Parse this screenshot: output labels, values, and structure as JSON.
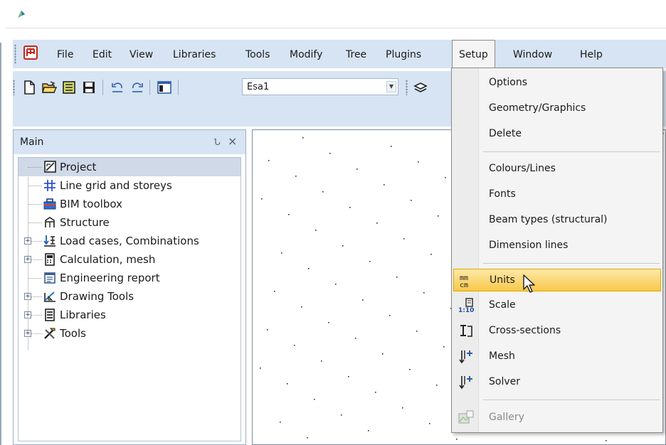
{
  "menubar": {
    "items": [
      "File",
      "Edit",
      "View",
      "Libraries",
      "Tools",
      "Modify",
      "Tree",
      "Plugins",
      "Setup",
      "Window",
      "Help"
    ],
    "active": "Setup"
  },
  "toolbar": {
    "project_combo_value": "Esa1"
  },
  "panel": {
    "title": "Main",
    "pin_glyph": "Ն",
    "close_glyph": "×"
  },
  "tree": {
    "items": [
      {
        "label": "Project",
        "icon": "project-icon",
        "expandable": false,
        "selected": true
      },
      {
        "label": "Line grid and storeys",
        "icon": "line-grid-icon",
        "expandable": false,
        "selected": false
      },
      {
        "label": "BIM toolbox",
        "icon": "bim-toolbox-icon",
        "expandable": false,
        "selected": false
      },
      {
        "label": "Structure",
        "icon": "structure-icon",
        "expandable": false,
        "selected": false
      },
      {
        "label": "Load cases, Combinations",
        "icon": "load-cases-icon",
        "expandable": true,
        "selected": false
      },
      {
        "label": "Calculation, mesh",
        "icon": "calculator-icon",
        "expandable": true,
        "selected": false
      },
      {
        "label": "Engineering report",
        "icon": "report-icon",
        "expandable": false,
        "selected": false
      },
      {
        "label": "Drawing Tools",
        "icon": "drawing-tools-icon",
        "expandable": true,
        "selected": false
      },
      {
        "label": "Libraries",
        "icon": "libraries-icon",
        "expandable": true,
        "selected": false
      },
      {
        "label": "Tools",
        "icon": "tools-icon",
        "expandable": true,
        "selected": false
      }
    ]
  },
  "setup_menu": {
    "items": [
      {
        "label": "Options",
        "icon": null,
        "disabled": false
      },
      {
        "label": "Geometry/Graphics",
        "icon": null,
        "disabled": false
      },
      {
        "label": "Delete",
        "icon": null,
        "disabled": false
      },
      {
        "label": "Colours/Lines",
        "icon": null,
        "disabled": false
      },
      {
        "label": "Fonts",
        "icon": null,
        "disabled": false
      },
      {
        "label": "Beam types (structural)",
        "icon": null,
        "disabled": false
      },
      {
        "label": "Dimension lines",
        "icon": null,
        "disabled": false
      },
      {
        "label": "Units",
        "icon": "units-icon",
        "icon_text_top": "mm",
        "icon_text_bottom": "cm",
        "disabled": false,
        "highlighted": true
      },
      {
        "label": "Scale",
        "icon": "scale-icon",
        "icon_text_bottom": "1:10",
        "disabled": false
      },
      {
        "label": "Cross-sections",
        "icon": "cross-section-icon",
        "disabled": false
      },
      {
        "label": "Mesh",
        "icon": "mesh-icon",
        "disabled": false
      },
      {
        "label": "Solver",
        "icon": "solver-icon",
        "disabled": false
      },
      {
        "label": "Gallery",
        "icon": "gallery-icon",
        "disabled": true
      }
    ]
  },
  "colors": {
    "chrome_blue": "#d6e4f3",
    "tree_selected": "#cfd9e8",
    "menu_highlight": "#f8c84a",
    "menu_background": "#f4f4f4"
  }
}
